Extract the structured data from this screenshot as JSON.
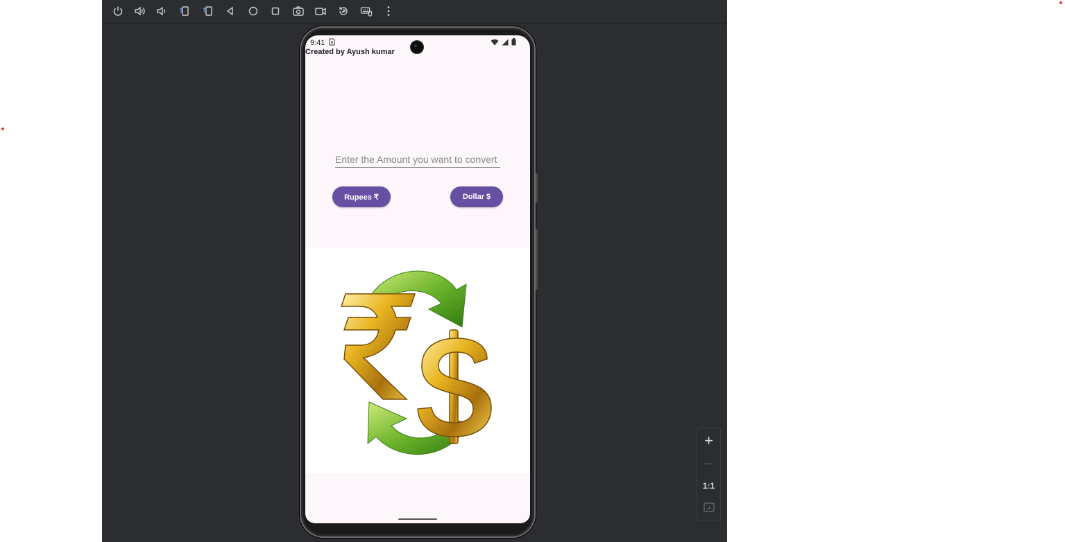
{
  "toolbar": {
    "icons": [
      "power-icon",
      "volume-up-icon",
      "volume-down-icon",
      "rotate-left-icon",
      "rotate-right-icon",
      "back-icon",
      "home-icon",
      "overview-icon",
      "screenshot-icon",
      "screen-record-icon",
      "reset-icon",
      "keyboard-mouse-icon",
      "more-options-icon"
    ]
  },
  "phone": {
    "status": {
      "time": "9:41"
    },
    "credit": "Created by Ayush kumar",
    "amount_input": {
      "placeholder": "Enter the Amount you want to convert",
      "value": ""
    },
    "buttons": {
      "rupees": "Rupees ₹",
      "dollar": "Dollar $"
    },
    "hero_image": "rupee-dollar-exchange-icon"
  },
  "zoom": {
    "zoom_in": "+",
    "zoom_out": "—",
    "actual_size": "1:1",
    "fit_screen": "fit-screen-icon"
  },
  "colors": {
    "accent": "#6750a4",
    "screen_bg": "#fdf6fb",
    "emulator_bg": "#2b2d30"
  }
}
